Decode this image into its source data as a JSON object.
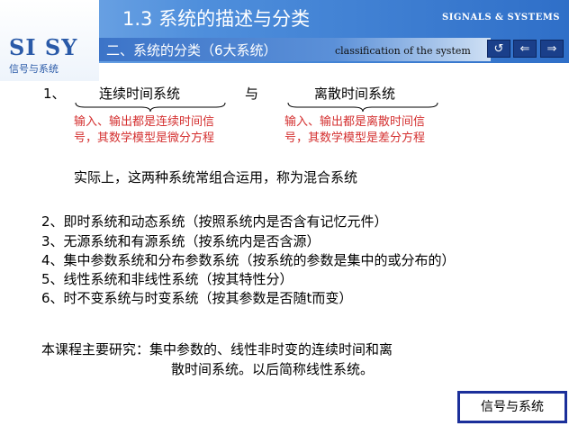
{
  "header": {
    "title": "1.3  系统的描述与分类",
    "brand": "SIGNALS & SYSTEMS",
    "logo_main": "SI SY",
    "logo_sub": "信号与系统",
    "subtitle": "二、系统的分类（6大系统）",
    "subtitle_en": "classification  of  the system"
  },
  "nav": {
    "refresh_glyph": "↺",
    "back_glyph": "⇐",
    "forward_glyph": "⇒"
  },
  "item1": {
    "num": "1、",
    "left": "连续时间系统",
    "and": "与",
    "right": "离散时间系统",
    "left_desc": [
      "输入、输出都是连续时间信",
      "号，其数学模型是微分方程"
    ],
    "right_desc": [
      "输入、输出都是离散时间信",
      "号，其数学模型是差分方程"
    ],
    "note": "实际上，这两种系统常组合运用，称为混合系统"
  },
  "items": [
    "2、即时系统和动态系统（按照系统内是否含有记忆元件）",
    "3、无源系统和有源系统（按系统内是否含源）",
    "4、集中参数系统和分布参数系统（按系统的参数是集中的或分布的）",
    "5、线性系统和非线性系统（按其特性分）",
    "6、时不变系统与时变系统（按其参数是否随t而变）"
  ],
  "summary": {
    "line1": "本课程主要研究：集中参数的、线性非时变的连续时间和离",
    "line2": "散时间系统。以后简称线性系统。"
  },
  "footer": {
    "label": "信号与系统"
  },
  "colors": {
    "header_blue": "#2f6fc8",
    "accent_red": "#d43030",
    "footer_border": "#1b2f9a"
  }
}
